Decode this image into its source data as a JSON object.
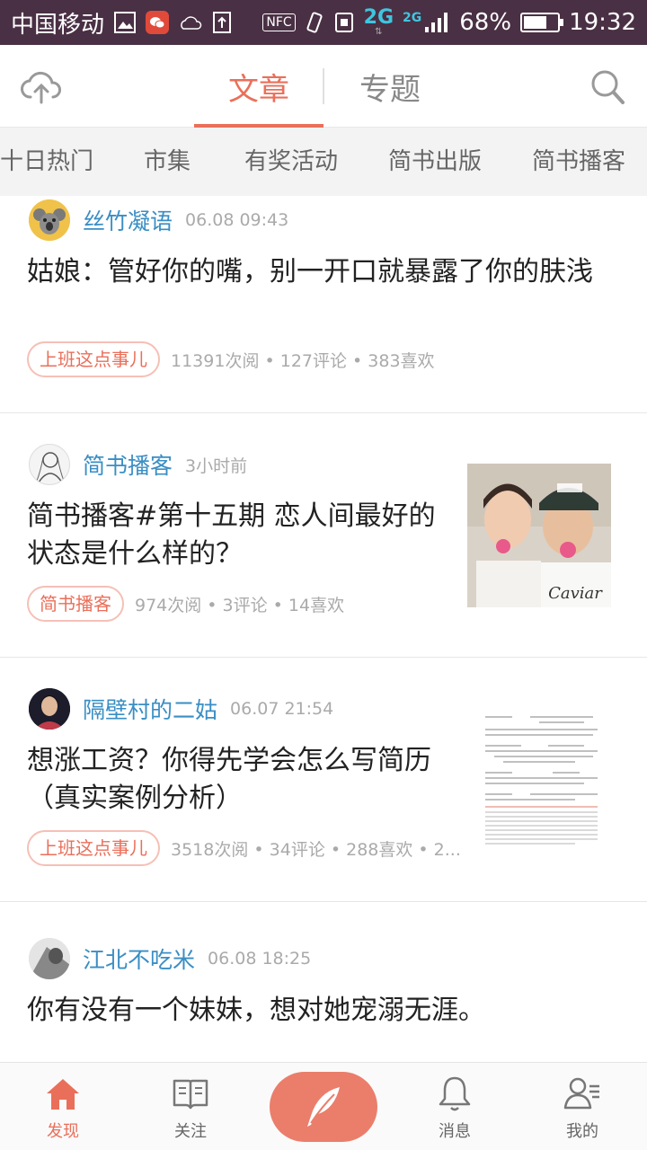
{
  "status_bar": {
    "carrier": "中国移动",
    "nfc": "NFC",
    "network_1": "2G",
    "network_2": "2G",
    "battery_percent": "68%",
    "battery_level": 0.68,
    "time": "19:32"
  },
  "nav": {
    "tab_articles": "文章",
    "tab_topics": "专题",
    "upload_icon": "cloud-upload-icon",
    "search_icon": "search-icon"
  },
  "categories": [
    "十日热门",
    "市集",
    "有奖活动",
    "简书出版",
    "简书播客"
  ],
  "posts": [
    {
      "author": "丝竹凝语",
      "time": "06.08 09:43",
      "title": "姑娘：管好你的嘴，别一开口就暴露了你的肤浅",
      "tag": "上班这点事儿",
      "stats": "11391次阅 • 127评论 • 383喜欢"
    },
    {
      "author": "简书播客",
      "time": "3小时前",
      "title": "简书播客#第十五期 恋人间最好的状态是什么样的？",
      "tag": "简书播客",
      "stats": "974次阅 • 3评论 • 14喜欢",
      "thumb_text": "Caviar"
    },
    {
      "author": "隔壁村的二姑",
      "time": "06.07 21:54",
      "title": "想涨工资？你得先学会怎么写简历（真实案例分析）",
      "tag": "上班这点事儿",
      "stats": "3518次阅 • 34评论 • 288喜欢 • 2..."
    },
    {
      "author": "江北不吃米",
      "time": "06.08 18:25",
      "title": "你有没有一个妹妹，想对她宠溺无涯。",
      "tag": "",
      "stats": ""
    }
  ],
  "bottom_nav": {
    "discover": "发现",
    "follow": "关注",
    "messages": "消息",
    "me": "我的"
  },
  "colors": {
    "accent": "#ea6f5a",
    "status_bar": "#4a3044",
    "author": "#3a8ec4"
  }
}
